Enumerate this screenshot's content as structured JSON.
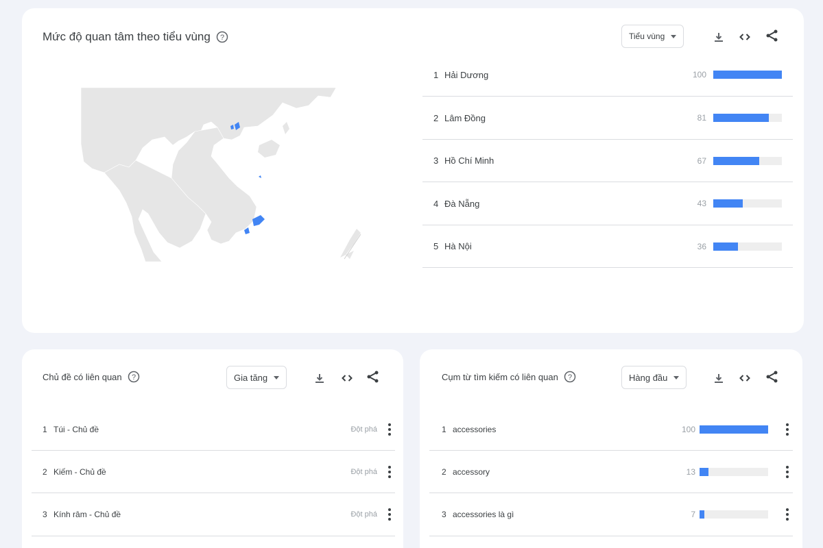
{
  "region_card": {
    "title": "Mức độ quan tâm theo tiểu vùng",
    "dropdown_label": "Tiểu vùng",
    "rows": [
      {
        "rank": "1",
        "name": "Hải Dương",
        "value": "100",
        "fraction": 1.0
      },
      {
        "rank": "2",
        "name": "Lâm Đồng",
        "value": "81",
        "fraction": 0.81
      },
      {
        "rank": "3",
        "name": "Hồ Chí Minh",
        "value": "67",
        "fraction": 0.67
      },
      {
        "rank": "4",
        "name": "Đà Nẵng",
        "value": "43",
        "fraction": 0.43
      },
      {
        "rank": "5",
        "name": "Hà Nội",
        "value": "36",
        "fraction": 0.36
      }
    ]
  },
  "topics_card": {
    "title": "Chủ đề có liên quan",
    "dropdown_label": "Gia tăng",
    "rows": [
      {
        "rank": "1",
        "name": "Túi - Chủ đề",
        "status": "Đột phá"
      },
      {
        "rank": "2",
        "name": "Kiếm - Chủ đề",
        "status": "Đột phá"
      },
      {
        "rank": "3",
        "name": "Kính râm - Chủ đề",
        "status": "Đột phá"
      }
    ]
  },
  "queries_card": {
    "title": "Cụm từ tìm kiếm có liên quan",
    "dropdown_label": "Hàng đầu",
    "rows": [
      {
        "rank": "1",
        "name": "accessories",
        "value": "100",
        "fraction": 1.0
      },
      {
        "rank": "2",
        "name": "accessory",
        "value": "13",
        "fraction": 0.13
      },
      {
        "rank": "3",
        "name": "accessories là gì",
        "value": "7",
        "fraction": 0.07
      }
    ]
  },
  "colors": {
    "accent": "#4285f4",
    "map_land": "#e6e6e6",
    "background": "#f1f3f9"
  },
  "icons": [
    "help-icon",
    "download-icon",
    "embed-icon",
    "share-icon",
    "more-vert-icon"
  ]
}
